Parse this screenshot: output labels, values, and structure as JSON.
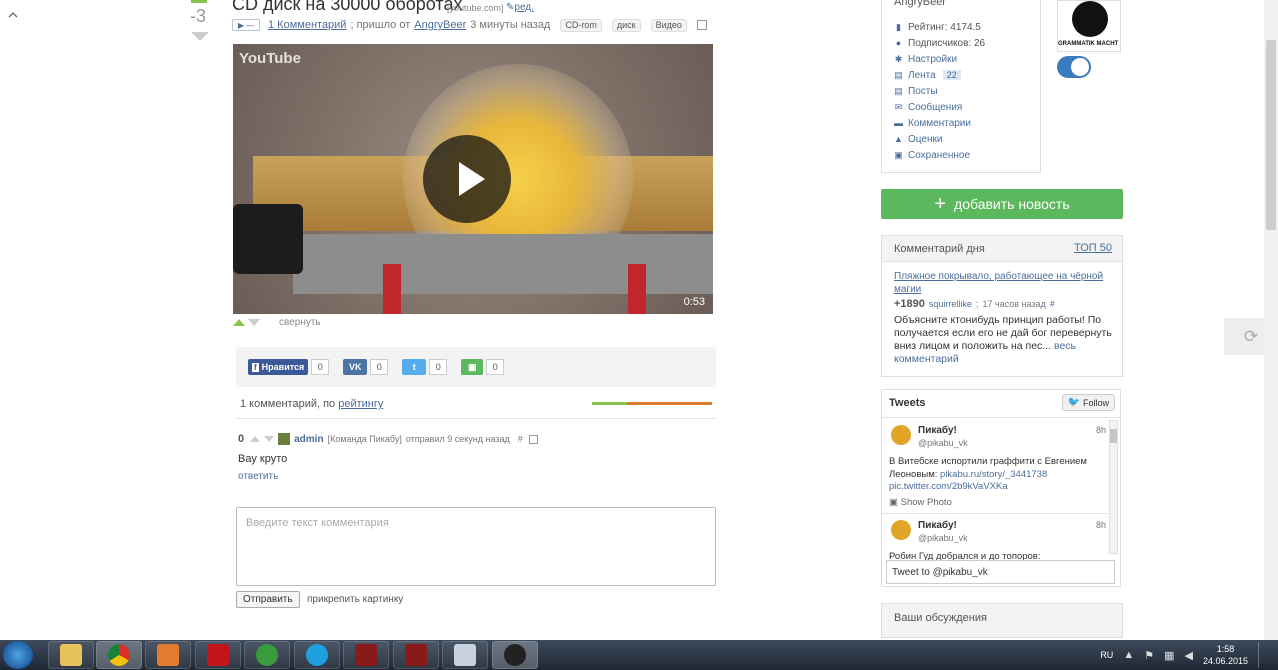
{
  "post": {
    "score": "-3",
    "title": "CD диск на 30000 оборотах",
    "source": "[youtube.com]",
    "edit_label": "ред.",
    "comments_link": "1 Комментарий",
    "posted_from": "; пришло от",
    "author": "AngryBeer",
    "time_ago": "3 минуты назад",
    "tags": [
      "CD-rom",
      "диск",
      "Видео"
    ],
    "video": {
      "logo": "YouTube",
      "duration": "0:53"
    },
    "collapse_label": "свернуть"
  },
  "share": {
    "items": [
      {
        "label": "Нравится",
        "count": "0",
        "color": "#3b5998",
        "icon": "facebook-icon"
      },
      {
        "label": "",
        "count": "0",
        "color": "#4c75a3",
        "icon": "vk-icon"
      },
      {
        "label": "",
        "count": "0",
        "color": "#55acee",
        "icon": "twitter-icon"
      },
      {
        "label": "",
        "count": "0",
        "color": "#5cb85c",
        "icon": "save-icon"
      }
    ]
  },
  "comments": {
    "count_label": "1 комментарий, по",
    "sort_label": "рейтингу",
    "bar_colors": [
      "#8bc34a",
      "#e07b27"
    ],
    "list": [
      {
        "score": "0",
        "author": "admin",
        "team": "[Команда Пикабу]",
        "sent": "отправил 9 секунд назад",
        "anchor": "#",
        "text": "Вау круто",
        "reply": "ответить"
      }
    ],
    "input_placeholder": "Введите текст комментария",
    "submit_label": "Отправить",
    "attach_label": "прикрепить картинку"
  },
  "user_panel": {
    "name": "AngryBeer",
    "rows": [
      {
        "icon": "chart-icon",
        "label": "Рейтинг: 4174.5",
        "link": false,
        "badge": ""
      },
      {
        "icon": "person-icon",
        "label": "Подписчиков: 26",
        "link": false,
        "badge": ""
      },
      {
        "icon": "gear-icon",
        "label": "Настройки",
        "link": true,
        "badge": ""
      },
      {
        "icon": "feed-icon",
        "label": "Лента",
        "link": true,
        "badge": "22"
      },
      {
        "icon": "posts-icon",
        "label": "Посты",
        "link": true,
        "badge": ""
      },
      {
        "icon": "mail-icon",
        "label": "Сообщения",
        "link": true,
        "badge": ""
      },
      {
        "icon": "comment-icon",
        "label": "Комментарии",
        "link": true,
        "badge": ""
      },
      {
        "icon": "triangle-icon",
        "label": "Оценки",
        "link": true,
        "badge": ""
      },
      {
        "icon": "save-icon",
        "label": "Сохраненное",
        "link": true,
        "badge": ""
      }
    ],
    "emblem_text": "GRAMMATIK MACHT FREI"
  },
  "add_news_label": "добавить новость",
  "comment_of_day": {
    "title": "Комментарий дня",
    "top_link": "ТОП 50",
    "post_link": "Пляжное покрывало, работающее на чёрной магии",
    "points": "+1890",
    "user": "squirrellike",
    "time": "17 часов назад",
    "anchor": "#",
    "text": "Объясните ктонибудь принцип работы! По получается если его не дай бог перевернуть вниз лицом и положить на пес...",
    "all_comments": "весь комментарий"
  },
  "tweets": {
    "title": "Tweets",
    "follow_label": "Follow",
    "items": [
      {
        "name": "Пикабу!",
        "handle": "@pikabu_vk",
        "time": "8h",
        "text_a": "В Витебске испортили граффити с Евгением Леоновым: ",
        "link_a": "pikabu.ru/story/_3441738",
        "link_b": " pic.twitter.com/2b9kVaVXKa",
        "photo_label": "Show Photo"
      },
      {
        "name": "Пикабу!",
        "handle": "@pikabu_vk",
        "time": "8h",
        "text_a": "Робин Гуд добрался и до топоров:",
        "link_a": "",
        "link_b": "",
        "photo_label": ""
      }
    ],
    "input_value": "Tweet to @pikabu_vk"
  },
  "discussions_title": "Ваши обсуждения",
  "taskbar": {
    "apps": [
      "explorer-icon",
      "chrome-icon",
      "media-player-icon",
      "flash-icon",
      "utorrent-icon",
      "skype-icon",
      "gpu-tweak-icon",
      "gpu-monitor-icon",
      "calculator-icon",
      "snipping-icon"
    ],
    "lang": "RU",
    "time": "1:58",
    "date": "24.06.2015"
  }
}
